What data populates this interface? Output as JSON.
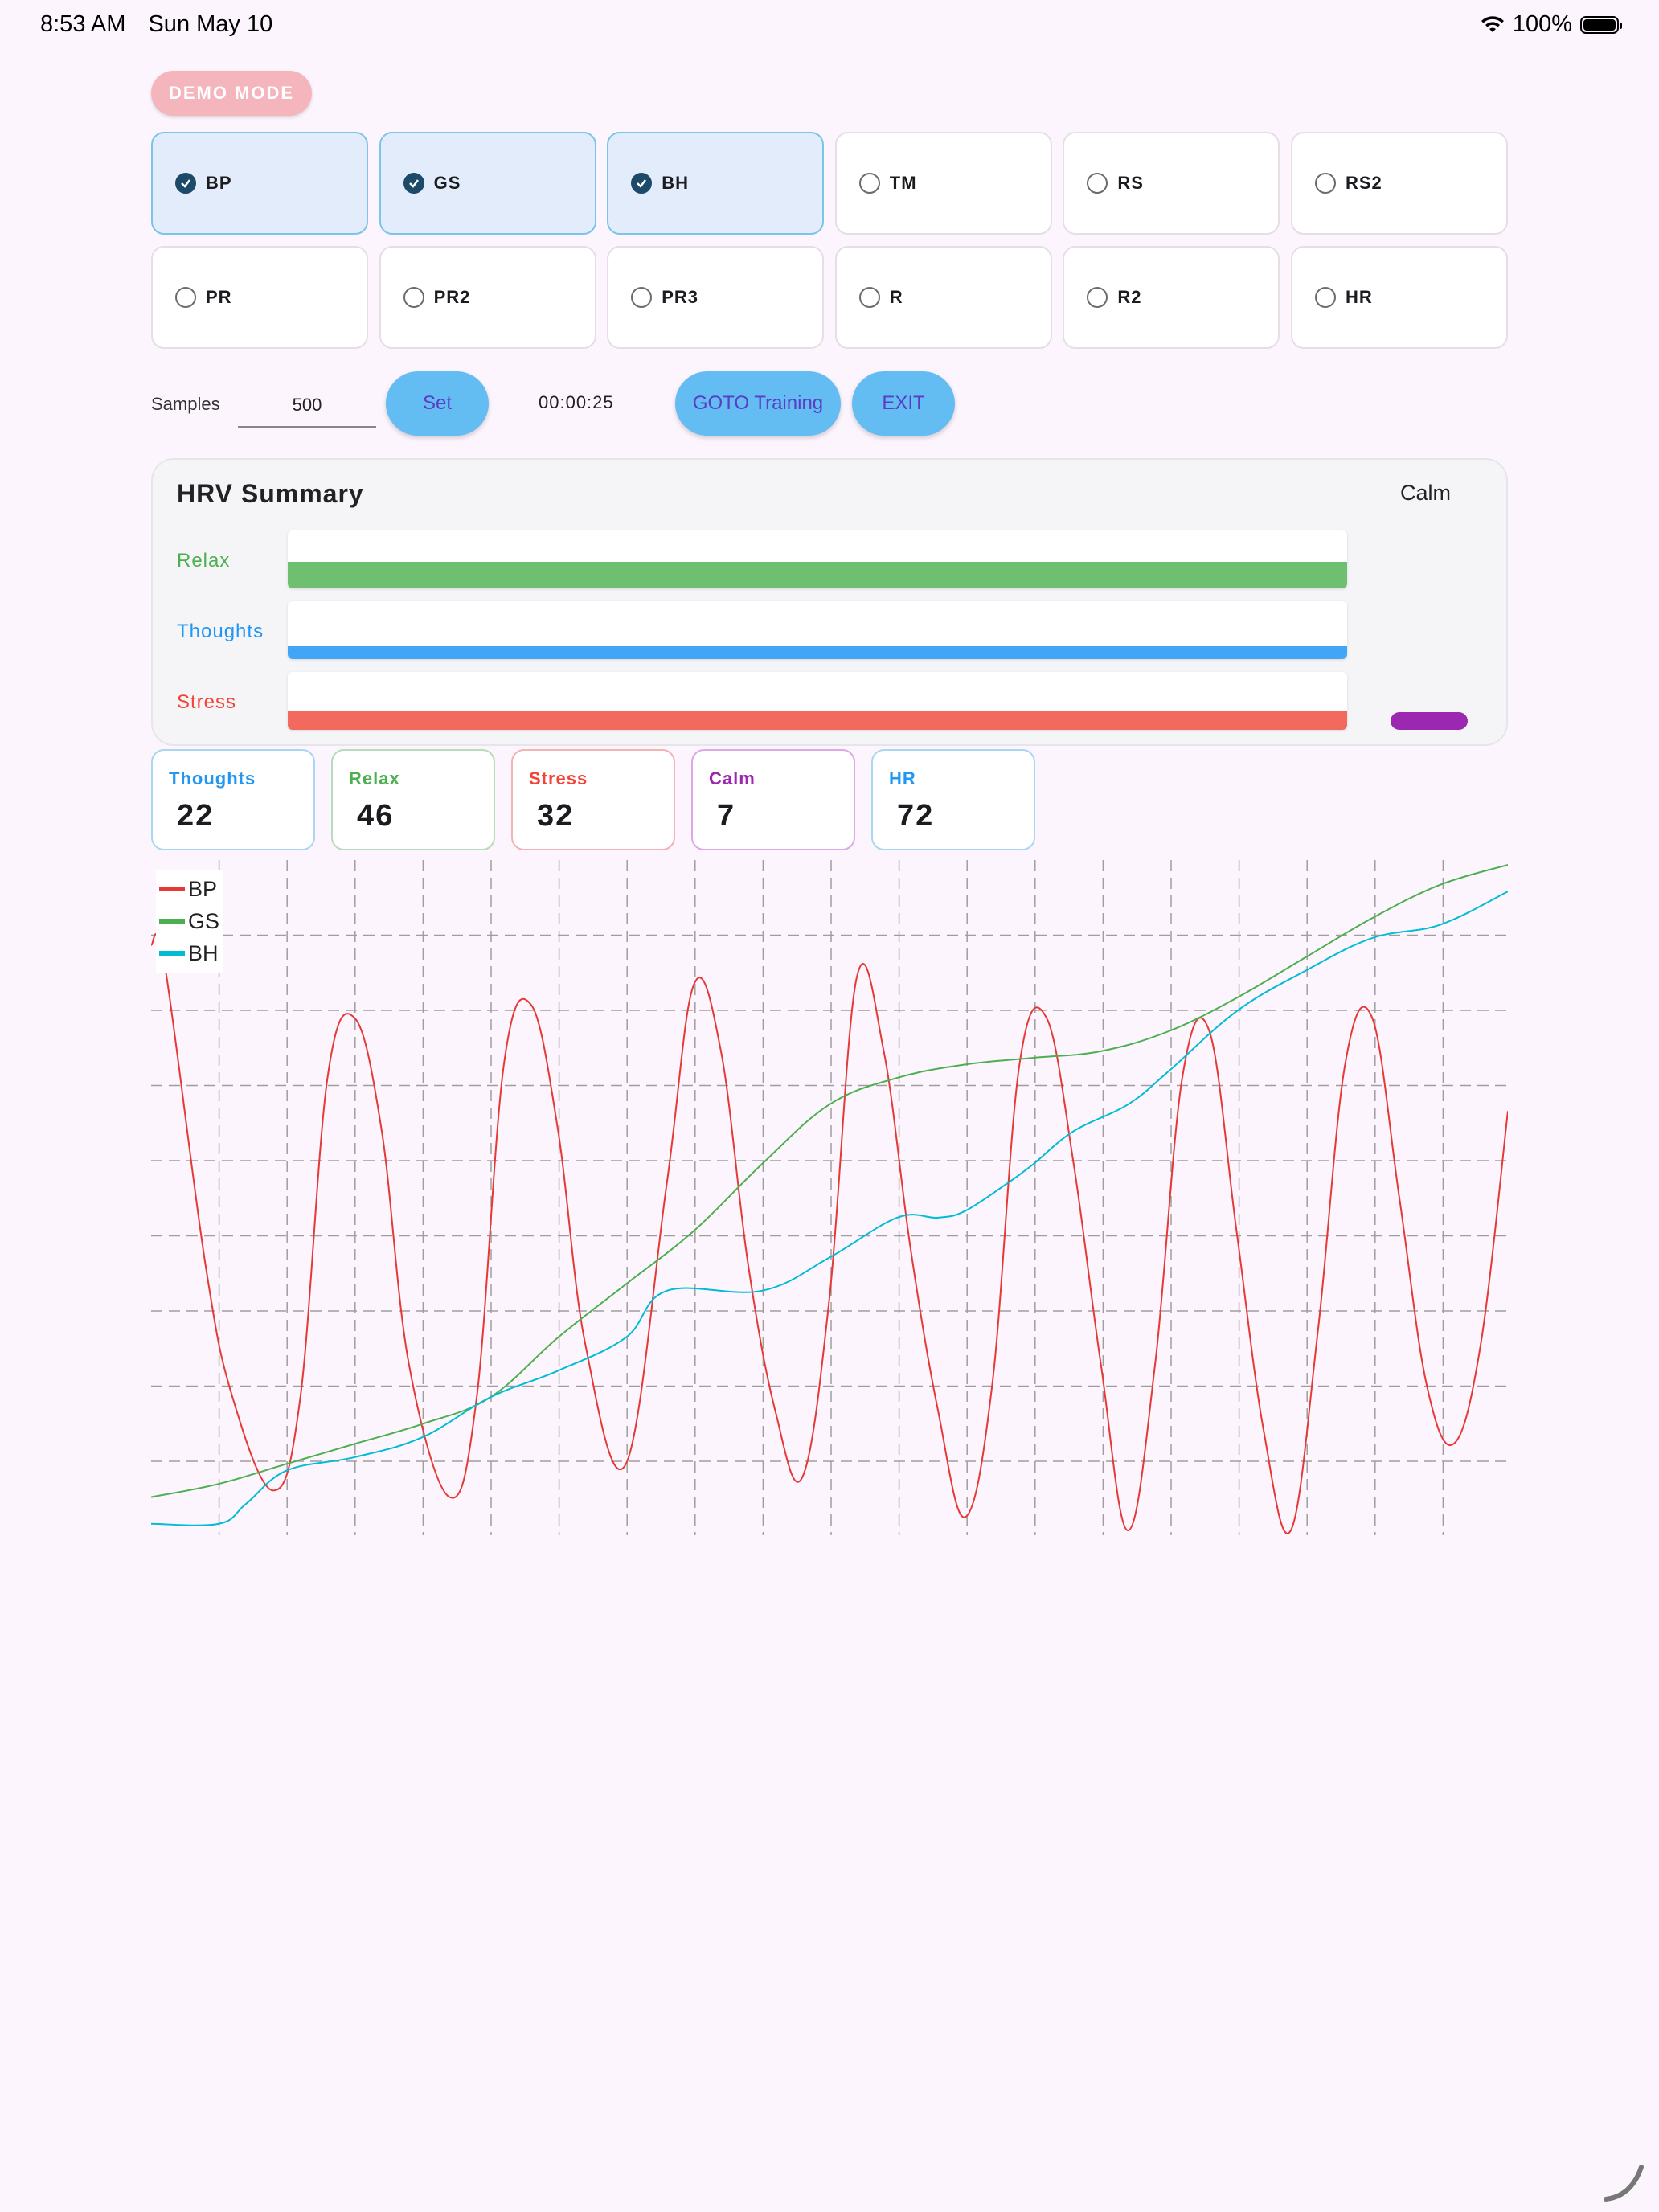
{
  "status_bar": {
    "time": "8:53 AM",
    "date": "Sun May 10",
    "battery": "100%"
  },
  "demo_badge": "DEMO MODE",
  "sensors": [
    {
      "label": "BP",
      "checked": true
    },
    {
      "label": "GS",
      "checked": true
    },
    {
      "label": "BH",
      "checked": true
    },
    {
      "label": "TM",
      "checked": false
    },
    {
      "label": "RS",
      "checked": false
    },
    {
      "label": "RS2",
      "checked": false
    },
    {
      "label": "PR",
      "checked": false
    },
    {
      "label": "PR2",
      "checked": false
    },
    {
      "label": "PR3",
      "checked": false
    },
    {
      "label": "R",
      "checked": false
    },
    {
      "label": "R2",
      "checked": false
    },
    {
      "label": "HR",
      "checked": false
    }
  ],
  "controls": {
    "samples_label": "Samples",
    "samples_value": "500",
    "set_label": "Set",
    "timer": "00:00:25",
    "goto_training_label": "GOTO Training",
    "exit_label": "EXIT"
  },
  "hrv_summary": {
    "title": "HRV Summary",
    "state": "Calm",
    "rows": [
      {
        "label": "Relax",
        "color": "#4caf50",
        "bar_color": "#6ec070",
        "level": 0.46
      },
      {
        "label": "Thoughts",
        "color": "#2196f3",
        "bar_color": "#42a5f5",
        "level": 0.22
      },
      {
        "label": "Stress",
        "color": "#f44336",
        "bar_color": "#f2695e",
        "level": 0.32
      }
    ],
    "calm_color": "#9c27b0"
  },
  "stats": [
    {
      "label": "Thoughts",
      "value": "22",
      "color": "#2196f3",
      "border": "#a9d7f3"
    },
    {
      "label": "Relax",
      "value": "46",
      "color": "#4caf50",
      "border": "#b6dcb8"
    },
    {
      "label": "Stress",
      "value": "32",
      "color": "#f44336",
      "border": "#f4b3b0"
    },
    {
      "label": "Calm",
      "value": "7",
      "color": "#9c27b0",
      "border": "#dca8e6"
    },
    {
      "label": "HR",
      "value": "72",
      "color": "#2196f3",
      "border": "#a9d7f3"
    }
  ],
  "chart_data": {
    "type": "line",
    "title": "",
    "xlabel": "",
    "ylabel": "",
    "grid": true,
    "legend_placement": "top-left",
    "xlim": [
      0,
      100
    ],
    "ylim": [
      0,
      100
    ],
    "series": [
      {
        "name": "BP",
        "color": "#e53935",
        "x": [
          0,
          1,
          4,
          6,
          9,
          11,
          13,
          15,
          17,
          19,
          22,
          24,
          26,
          28,
          30,
          32,
          35,
          38,
          40,
          42,
          44,
          46,
          48,
          50,
          52,
          54,
          56,
          58,
          60,
          62,
          64,
          66,
          68,
          70,
          72,
          74,
          76,
          78,
          80,
          82,
          84,
          86,
          88,
          90,
          92,
          94,
          96,
          98,
          100
        ],
        "y": [
          88,
          85,
          40,
          20,
          6,
          20,
          68,
          77,
          60,
          25,
          5,
          20,
          70,
          79,
          60,
          28,
          10,
          52,
          82,
          72,
          40,
          18,
          8,
          35,
          83,
          72,
          42,
          18,
          2,
          22,
          70,
          77,
          55,
          25,
          0,
          25,
          68,
          75,
          45,
          15,
          0,
          30,
          70,
          77,
          50,
          22,
          13,
          28,
          63
        ]
      },
      {
        "name": "GS",
        "color": "#4caf50",
        "x": [
          0,
          5,
          10,
          15,
          20,
          25,
          30,
          35,
          40,
          45,
          50,
          55,
          60,
          65,
          70,
          75,
          80,
          85,
          90,
          95,
          100
        ],
        "y": [
          5,
          7,
          10,
          13,
          16,
          20,
          29,
          37,
          45,
          55,
          64,
          68,
          70,
          71,
          72,
          75,
          80,
          86,
          92,
          97,
          100
        ]
      },
      {
        "name": "BH",
        "color": "#00bcd4",
        "x": [
          0,
          5,
          7,
          10,
          15,
          20,
          25,
          30,
          35,
          38,
          45,
          50,
          55,
          58,
          60,
          63,
          65,
          68,
          72,
          75,
          80,
          85,
          90,
          95,
          100
        ],
        "y": [
          1,
          1,
          4,
          9,
          11,
          14,
          20,
          24,
          29,
          36,
          36,
          41,
          47,
          47,
          48,
          52,
          55,
          60,
          64,
          69,
          78,
          84,
          89,
          91,
          96
        ]
      }
    ]
  }
}
